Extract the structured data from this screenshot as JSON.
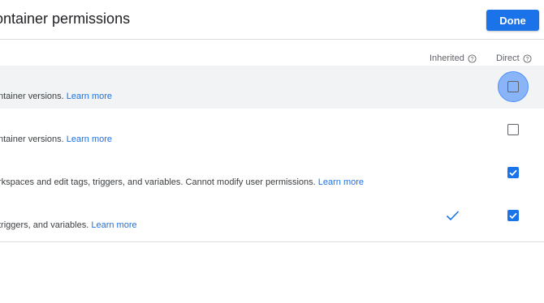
{
  "header": {
    "title": "ontainer permissions",
    "done_label": "Done"
  },
  "columns": {
    "inherited_label": "Inherited",
    "direct_label": "Direct",
    "help_icon": "question-circle-icon"
  },
  "rows": [
    {
      "text": "ntainer versions.",
      "link": "Learn more",
      "inherited": false,
      "direct": false,
      "focused": true
    },
    {
      "text": "ntainer versions.",
      "link": "Learn more",
      "inherited": false,
      "direct": false,
      "focused": false
    },
    {
      "text": "rkspaces and edit tags, triggers, and variables. Cannot modify user permissions.",
      "link": "Learn more",
      "inherited": false,
      "direct": true,
      "focused": false
    },
    {
      "text": " triggers, and variables.",
      "link": "Learn more",
      "inherited": true,
      "direct": true,
      "focused": false
    }
  ],
  "colors": {
    "accent": "#1a73e8",
    "highlight_row": "#f1f3f4",
    "focus_ring": "#8ab4f8"
  }
}
